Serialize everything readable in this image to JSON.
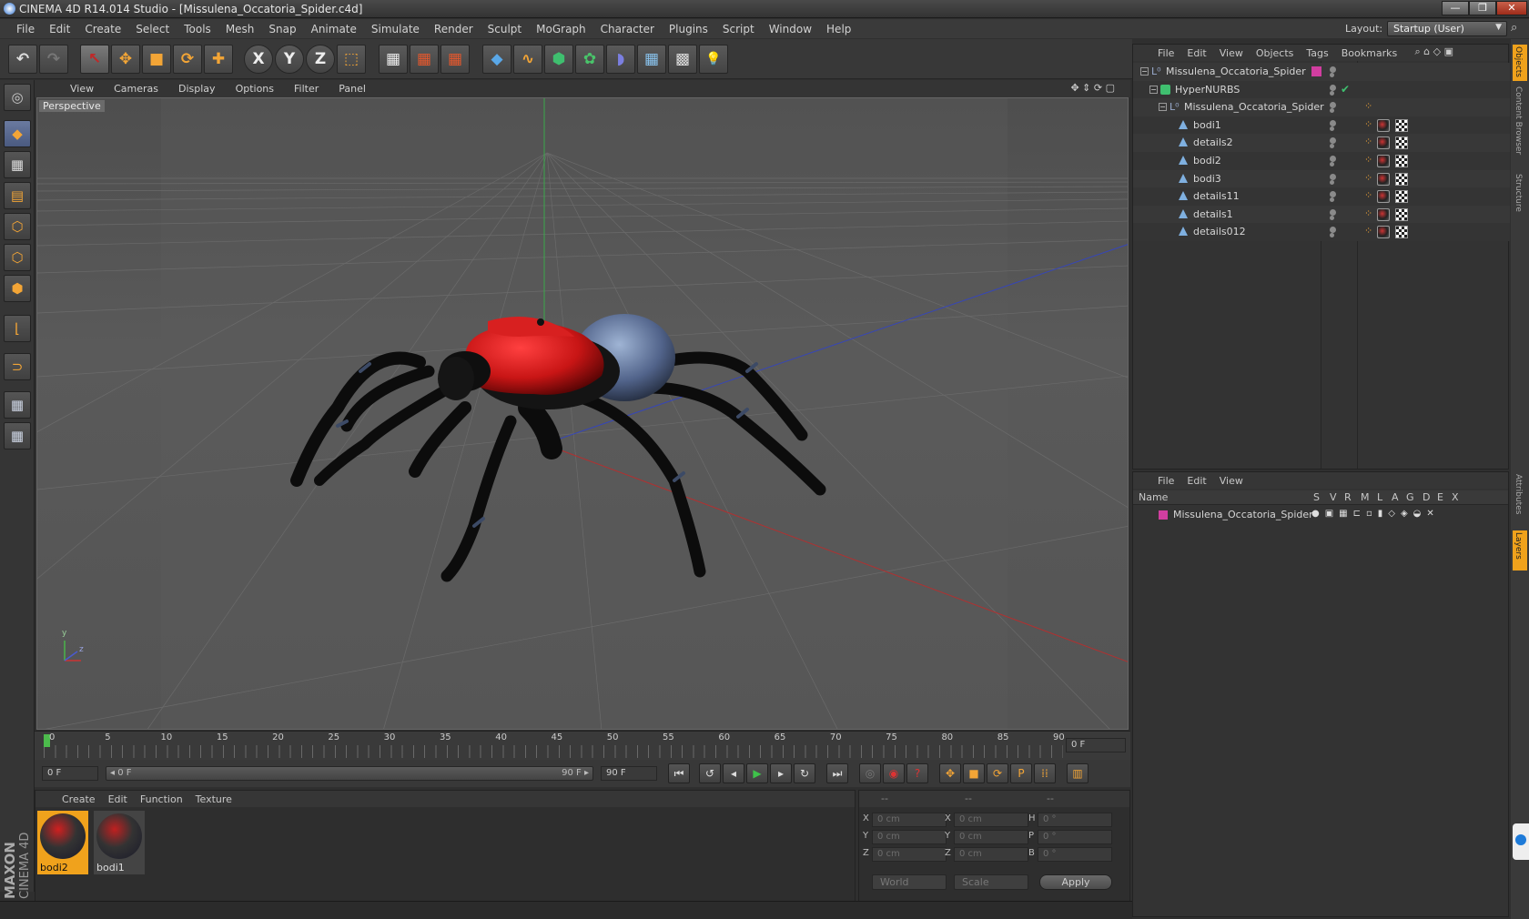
{
  "window": {
    "title": "CINEMA 4D R14.014 Studio - [Missulena_Occatoria_Spider.c4d]",
    "min": "—",
    "max": "❐",
    "close": "✕"
  },
  "menu": [
    "File",
    "Edit",
    "Create",
    "Select",
    "Tools",
    "Mesh",
    "Snap",
    "Animate",
    "Simulate",
    "Render",
    "Sculpt",
    "MoGraph",
    "Character",
    "Plugins",
    "Script",
    "Window",
    "Help"
  ],
  "layout": {
    "label": "Layout:",
    "value": "Startup (User)"
  },
  "toolbar": {
    "undo": "↶",
    "redo": "↷",
    "select": "↖",
    "move": "✥",
    "scale": "■",
    "rotate": "⟳",
    "add": "✚",
    "x": "X",
    "y": "Y",
    "z": "Z",
    "coord": "⬚",
    "render_view": "▦",
    "render_pic": "▦",
    "render_settings": "▦",
    "cube": "◆",
    "spline": "∿",
    "nurbs": "⬢",
    "array": "✿",
    "deformer": "◗",
    "floor": "▦",
    "camera": "▩",
    "light": "💡"
  },
  "viewport": {
    "menu": [
      "View",
      "Cameras",
      "Display",
      "Options",
      "Filter",
      "Panel"
    ],
    "label": "Perspective",
    "axis_y": "y",
    "axis_z": "z"
  },
  "timeline": {
    "ticks": [
      "0",
      "5",
      "10",
      "15",
      "20",
      "25",
      "30",
      "35",
      "40",
      "45",
      "50",
      "55",
      "60",
      "65",
      "70",
      "75",
      "80",
      "85",
      "90"
    ],
    "current_frame": "0 F"
  },
  "transport": {
    "start": "0 F",
    "range_start": "◂ 0 F",
    "range_end": "90 F ▸",
    "end": "90 F"
  },
  "material_manager": {
    "menu": [
      "Create",
      "Edit",
      "Function",
      "Texture"
    ],
    "materials": [
      {
        "name": "bodi2"
      },
      {
        "name": "bodi1"
      }
    ]
  },
  "coordinates": {
    "headers": [
      "--",
      "--",
      "--"
    ],
    "rows": [
      {
        "a": "X",
        "av": "0 cm",
        "b": "X",
        "bv": "0 cm",
        "c": "H",
        "cv": "0 °"
      },
      {
        "a": "Y",
        "av": "0 cm",
        "b": "Y",
        "bv": "0 cm",
        "c": "P",
        "cv": "0 °"
      },
      {
        "a": "Z",
        "av": "0 cm",
        "b": "Z",
        "bv": "0 cm",
        "c": "B",
        "cv": "0 °"
      }
    ],
    "mode": "World",
    "transform": "Scale",
    "apply": "Apply"
  },
  "object_manager": {
    "menu": [
      "File",
      "Edit",
      "View",
      "Objects",
      "Tags",
      "Bookmarks"
    ],
    "objects": [
      {
        "name": "Missulena_Occatoria_Spider",
        "indent": 0
      },
      {
        "name": "HyperNURBS",
        "indent": 1
      },
      {
        "name": "Missulena_Occatoria_Spider",
        "indent": 2
      },
      {
        "name": "bodi1",
        "indent": 3
      },
      {
        "name": "details2",
        "indent": 3
      },
      {
        "name": "bodi2",
        "indent": 3
      },
      {
        "name": "bodi3",
        "indent": 3
      },
      {
        "name": "details11",
        "indent": 3
      },
      {
        "name": "details1",
        "indent": 3
      },
      {
        "name": "details012",
        "indent": 3
      }
    ]
  },
  "layer_manager": {
    "menu": [
      "File",
      "Edit",
      "View"
    ],
    "columns": [
      "Name",
      "S",
      "V",
      "R",
      "M",
      "L",
      "A",
      "G",
      "D",
      "E",
      "X"
    ],
    "layers": [
      {
        "name": "Missulena_Occatoria_Spider",
        "color": "#d13ea0"
      }
    ]
  },
  "right_tabs": [
    "Objects",
    "Content Browser",
    "Structure",
    "Attributes",
    "Layers"
  ],
  "branding": {
    "maxon": "MAXON",
    "cinema": "CINEMA 4D"
  },
  "colors": {
    "accent": "#f3a536",
    "selection": "#f0a21c",
    "layer": "#d13ea0"
  }
}
